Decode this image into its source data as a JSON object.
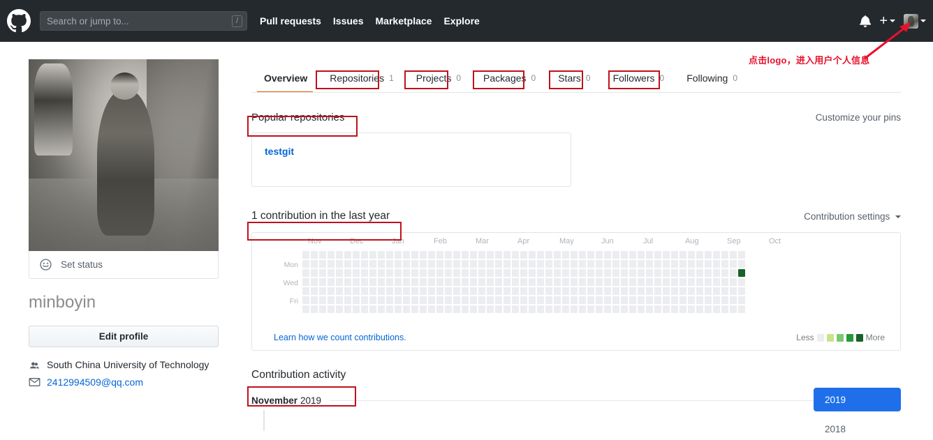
{
  "header": {
    "logo_icon": "github-logo-icon",
    "search": {
      "placeholder": "Search or jump to...",
      "shortcut": "/"
    },
    "nav": [
      {
        "label": "Pull requests"
      },
      {
        "label": "Issues"
      },
      {
        "label": "Marketplace"
      },
      {
        "label": "Explore"
      }
    ],
    "notifications_icon": "bell-icon",
    "create_new_icon": "plus-icon",
    "avatar_icon": "avatar"
  },
  "annotation": {
    "text": "点击logo，进入用户个人信息",
    "color": "#e8112d"
  },
  "sidebar": {
    "avatar_alt": "user-avatar-photo",
    "status": {
      "icon": "smiley-icon",
      "label": "Set status"
    },
    "username": "minboyin",
    "edit_profile_label": "Edit profile",
    "organization": {
      "icon": "organization-icon",
      "label": "South China University of Technology"
    },
    "email": {
      "icon": "mail-icon",
      "label": "2412994509@qq.com"
    }
  },
  "main": {
    "tabs": [
      {
        "label": "Overview",
        "count": "",
        "active": true
      },
      {
        "label": "Repositories",
        "count": "1",
        "active": false
      },
      {
        "label": "Projects",
        "count": "0",
        "active": false
      },
      {
        "label": "Packages",
        "count": "0",
        "active": false
      },
      {
        "label": "Stars",
        "count": "0",
        "active": false
      },
      {
        "label": "Followers",
        "count": "0",
        "active": false
      },
      {
        "label": "Following",
        "count": "0",
        "active": false
      }
    ],
    "popular": {
      "title": "Popular repositories",
      "customize_label": "Customize your pins",
      "repos": [
        {
          "name": "testgit"
        }
      ]
    },
    "contributions": {
      "title": "1 contribution in the last year",
      "settings_label": "Contribution settings",
      "months": [
        "Nov",
        "Dec",
        "Jan",
        "Feb",
        "Mar",
        "Apr",
        "May",
        "Jun",
        "Jul",
        "Aug",
        "Sep",
        "Oct"
      ],
      "days": [
        "Mon",
        "Wed",
        "Fri"
      ],
      "learn_label": "Learn how we count contributions.",
      "legend_less": "Less",
      "legend_more": "More",
      "legend_colors": [
        "#ebedf0",
        "#c6e48b",
        "#7bc96f",
        "#239a3b",
        "#196127"
      ],
      "active_cell": {
        "column": 52,
        "row": 2,
        "color": "#196127",
        "count": 1
      }
    },
    "activity": {
      "title": "Contribution activity",
      "month_label": "November",
      "year_label": "2019"
    },
    "years": [
      {
        "label": "2019",
        "active": true
      },
      {
        "label": "2018",
        "active": false
      }
    ]
  }
}
